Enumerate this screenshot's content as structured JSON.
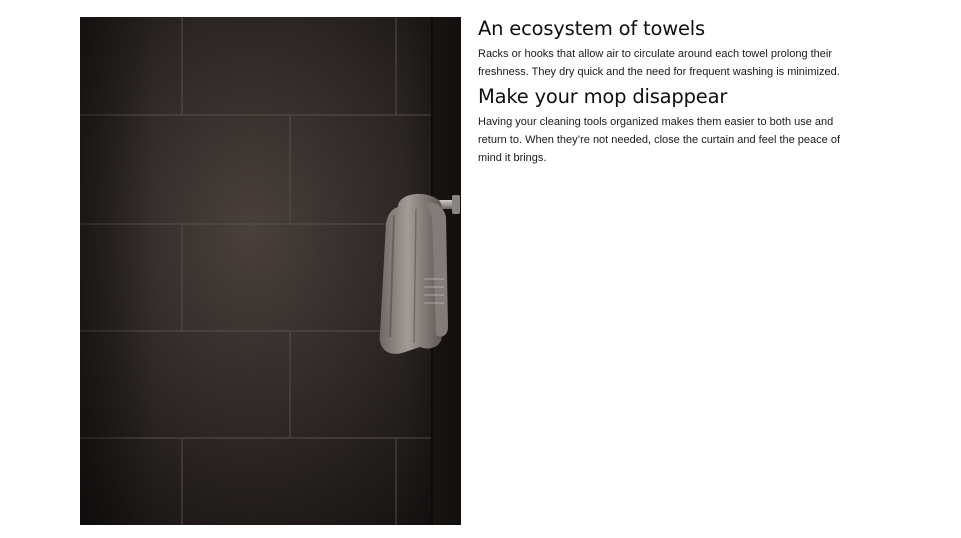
{
  "image": {
    "icon": "towel-rack-photo",
    "colors": {
      "wall_dark": "#1c1816",
      "wall_mid": "#3d3532",
      "grout": "#6a615c",
      "towel": "#9a918c",
      "rail": "#b7b2ae"
    }
  },
  "sections": [
    {
      "heading": "An ecosystem of towels",
      "body": "Racks or hooks that allow air to circulate around each towel prolong their freshness. They dry quick and the need for frequent washing is minimized."
    },
    {
      "heading": "Make your mop disappear",
      "body": "Having your cleaning tools organized makes them easier to both use and return to. When they’re not needed, close the curtain and feel the peace of mind it brings."
    }
  ]
}
